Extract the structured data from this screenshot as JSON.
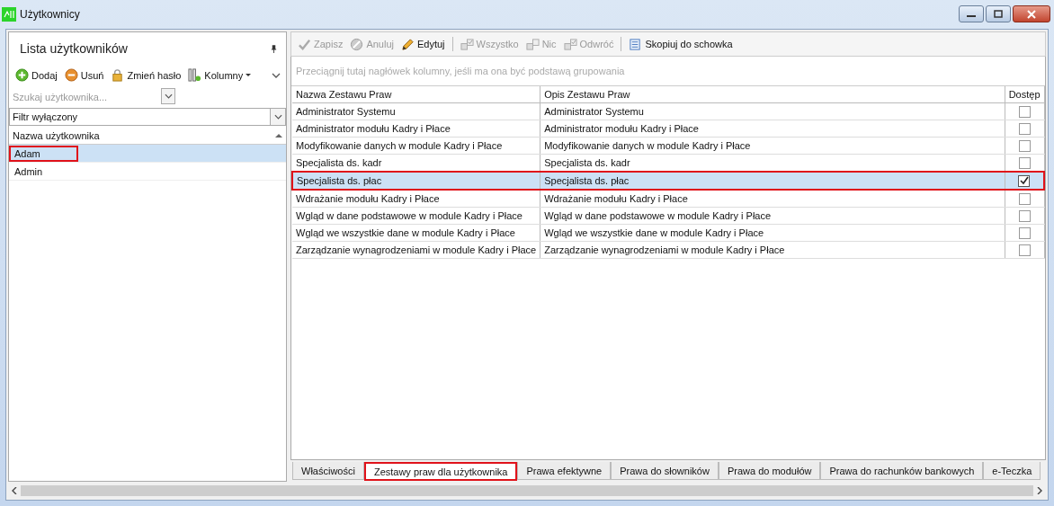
{
  "window": {
    "title": "Użytkownicy"
  },
  "left_panel": {
    "title": "Lista użytkowników",
    "toolbar": [
      {
        "kind": "add",
        "label": "Dodaj"
      },
      {
        "kind": "remove",
        "label": "Usuń"
      },
      {
        "kind": "lock",
        "label": "Zmień hasło"
      },
      {
        "kind": "columns",
        "label": "Kolumny"
      }
    ],
    "search": {
      "placeholder": "Szukaj użytkownika..."
    },
    "filter": {
      "value": "Filtr wyłączony"
    },
    "column": "Nazwa użytkownika",
    "users": [
      {
        "name": "Adam",
        "selected": true,
        "highlighted": true
      },
      {
        "name": "Admin",
        "selected": false,
        "highlighted": false
      }
    ]
  },
  "toolbar": [
    {
      "kind": "check",
      "label": "Zapisz",
      "disabled": true
    },
    {
      "kind": "cancel",
      "label": "Anuluj",
      "disabled": true
    },
    {
      "kind": "pencil",
      "label": "Edytuj",
      "disabled": false
    },
    {
      "kind": "separator"
    },
    {
      "kind": "all",
      "label": "Wszystko",
      "disabled": true
    },
    {
      "kind": "none",
      "label": "Nic",
      "disabled": true
    },
    {
      "kind": "invert",
      "label": "Odwróć",
      "disabled": true
    },
    {
      "kind": "separator"
    },
    {
      "kind": "copy",
      "label": "Skopiuj do schowka",
      "disabled": false
    }
  ],
  "group_hint": "Przeciągnij tutaj nagłówek kolumny, jeśli ma ona być podstawą grupowania",
  "table": {
    "columns": [
      "Nazwa Zestawu Praw",
      "Opis Zestawu Praw",
      "Dostęp"
    ],
    "rows": [
      {
        "name": "Administrator Systemu",
        "description": "Administrator Systemu",
        "checked": false,
        "selected": false,
        "highlighted": false
      },
      {
        "name": "Administrator modułu Kadry i Płace",
        "description": "Administrator modułu Kadry i Płace",
        "checked": false,
        "selected": false,
        "highlighted": false
      },
      {
        "name": "Modyfikowanie danych w module Kadry i Płace",
        "description": "Modyfikowanie danych w module Kadry i Płace",
        "checked": false,
        "selected": false,
        "highlighted": false
      },
      {
        "name": "Specjalista ds. kadr",
        "description": "Specjalista ds. kadr",
        "checked": false,
        "selected": false,
        "highlighted": false
      },
      {
        "name": "Specjalista ds. płac",
        "description": "Specjalista ds. płac",
        "checked": true,
        "selected": true,
        "highlighted": true
      },
      {
        "name": "Wdrażanie modułu Kadry i Płace",
        "description": "Wdrażanie modułu Kadry i Płace",
        "checked": false,
        "selected": false,
        "highlighted": false
      },
      {
        "name": "Wgląd w dane podstawowe w module Kadry i Płace",
        "description": "Wgląd w dane podstawowe w module Kadry i Płace",
        "checked": false,
        "selected": false,
        "highlighted": false
      },
      {
        "name": "Wgląd we wszystkie dane w module Kadry i Płace",
        "description": "Wgląd we wszystkie dane w module Kadry i Płace",
        "checked": false,
        "selected": false,
        "highlighted": false
      },
      {
        "name": "Zarządzanie wynagrodzeniami w module Kadry i Płace",
        "description": "Zarządzanie wynagrodzeniami w module Kadry i Płace",
        "checked": false,
        "selected": false,
        "highlighted": false
      }
    ]
  },
  "tabs": [
    {
      "label": "Właściwości",
      "selected": false,
      "highlighted": false
    },
    {
      "label": "Zestawy praw dla użytkownika",
      "selected": true,
      "highlighted": true
    },
    {
      "label": "Prawa efektywne",
      "selected": false,
      "highlighted": false
    },
    {
      "label": "Prawa do słowników",
      "selected": false,
      "highlighted": false
    },
    {
      "label": "Prawa do modułów",
      "selected": false,
      "highlighted": false
    },
    {
      "label": "Prawa do rachunków bankowych",
      "selected": false,
      "highlighted": false
    },
    {
      "label": "e-Teczka",
      "selected": false,
      "highlighted": false
    }
  ]
}
